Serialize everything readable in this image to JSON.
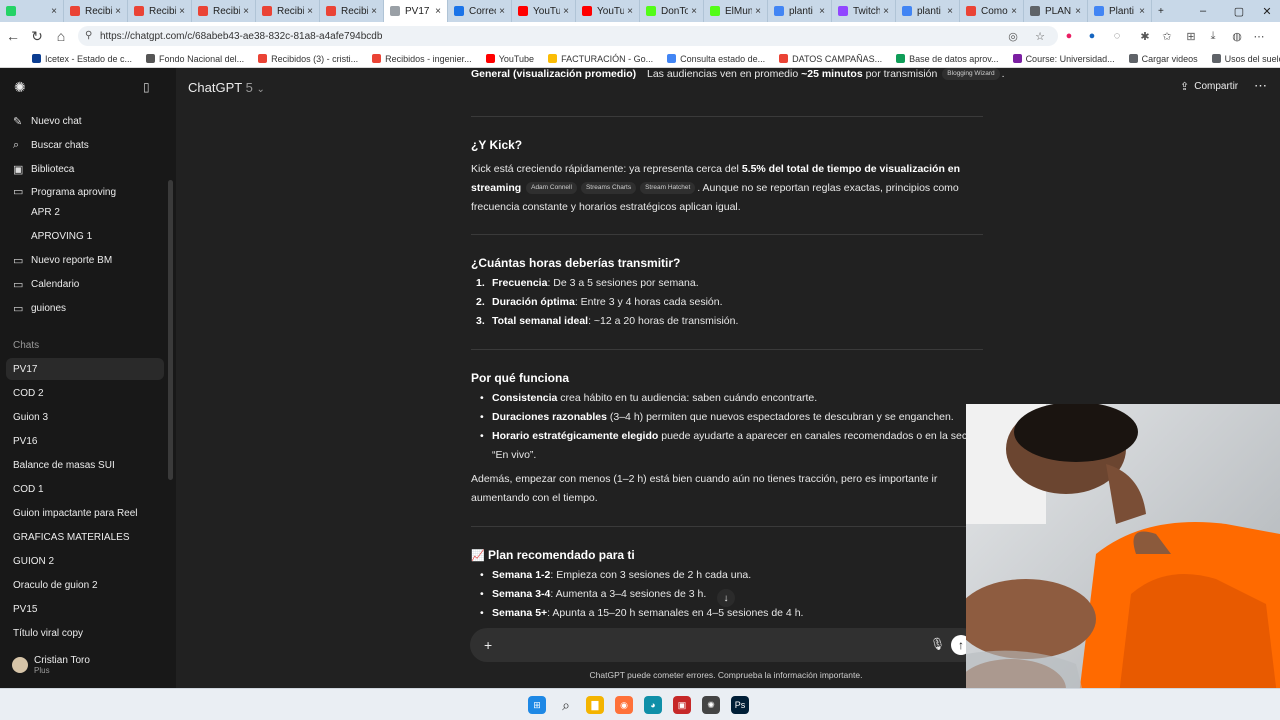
{
  "browser": {
    "tabs": [
      {
        "label": "",
        "color": "#25d366"
      },
      {
        "label": "Recibi",
        "color": "#ea4335"
      },
      {
        "label": "Recibi",
        "color": "#ea4335"
      },
      {
        "label": "Recibi",
        "color": "#ea4335"
      },
      {
        "label": "Recibi",
        "color": "#ea4335"
      },
      {
        "label": "Recibi",
        "color": "#ea4335"
      },
      {
        "label": "PV17",
        "color": "#9aa0a6",
        "active": true
      },
      {
        "label": "Correc",
        "color": "#1a73e8"
      },
      {
        "label": "YouTu",
        "color": "#ff0000"
      },
      {
        "label": "YouTu",
        "color": "#ff0000"
      },
      {
        "label": "DonTo",
        "color": "#53fc18"
      },
      {
        "label": "ElMun",
        "color": "#53fc18"
      },
      {
        "label": "planti",
        "color": "#4285f4"
      },
      {
        "label": "Twitch",
        "color": "#9146ff"
      },
      {
        "label": "planti",
        "color": "#4285f4"
      },
      {
        "label": "Como",
        "color": "#ea4335"
      },
      {
        "label": "PLAN",
        "color": "#5f6368"
      },
      {
        "label": "Planti",
        "color": "#4285f4"
      }
    ],
    "url": "https://chatgpt.com/c/68abeb43-ae38-832c-81a8-a4afe794bcdb",
    "bookmarks": [
      {
        "label": "Icetex - Estado de c...",
        "color": "#0b3d91"
      },
      {
        "label": "Fondo Nacional del...",
        "color": "#555555"
      },
      {
        "label": "Recibidos (3) - cristi...",
        "color": "#ea4335"
      },
      {
        "label": "Recibidos - ingenier...",
        "color": "#ea4335"
      },
      {
        "label": "YouTube",
        "color": "#ff0000"
      },
      {
        "label": "FACTURACIÓN - Go...",
        "color": "#fbbc04"
      },
      {
        "label": "Consulta estado de...",
        "color": "#4285f4"
      },
      {
        "label": "DATOS CAMPAÑAS...",
        "color": "#ea4335"
      },
      {
        "label": "Base de datos aprov...",
        "color": "#0f9d58"
      },
      {
        "label": "Course: Universidad...",
        "color": "#7b1fa2"
      },
      {
        "label": "Cargar videos",
        "color": "#5f6368"
      },
      {
        "label": "Usos del suelo palm...",
        "color": "#5f6368"
      }
    ]
  },
  "sidebar": {
    "top_items": [
      {
        "label": "Nuevo chat",
        "icon": "✎"
      },
      {
        "label": "Buscar chats",
        "icon": "⌕"
      },
      {
        "label": "Biblioteca",
        "icon": "▣"
      }
    ],
    "project_items": [
      {
        "label": "Programa aproving",
        "icon": "▭"
      },
      {
        "label": "APR 2",
        "icon": ""
      },
      {
        "label": "APROVING 1",
        "icon": ""
      },
      {
        "label": "Nuevo reporte BM",
        "icon": "▭"
      },
      {
        "label": "Calendario",
        "icon": "▭"
      },
      {
        "label": "guiones",
        "icon": "▭"
      }
    ],
    "chats_heading": "Chats",
    "chats": [
      "PV17",
      "COD 2",
      "Guion 3",
      "PV16",
      "Balance de masas SUI",
      "COD 1",
      "Guion impactante para Reel",
      "GRAFICAS MATERIALES",
      "GUION 2",
      "Oraculo de guion 2",
      "PV15",
      "Título viral copy"
    ],
    "user": {
      "name": "Cristian Toro",
      "plan": "Plus"
    }
  },
  "header": {
    "model": "ChatGPT",
    "version": "5",
    "share": "Compartir"
  },
  "content": {
    "top_row": {
      "label": "General (visualización promedio)",
      "text_pre": "Las audiencias ven en promedio ",
      "text_bold": "~25 minutos",
      "text_post": " por transmisión",
      "chip": "Blogging Wizard",
      "end": "."
    },
    "kick": {
      "title": "¿Y Kick?",
      "p_pre": "Kick está creciendo rápidamente: ya representa cerca del ",
      "p_bold": "5.5% del total de tiempo de visualización en streaming",
      "chips": [
        "Adam Connell",
        "Streams Charts",
        "Stream Hatchet"
      ],
      "p_post": ". Aunque no se reportan reglas exactas, principios como frecuencia constante y horarios estratégicos aplican igual."
    },
    "hours": {
      "title": "¿Cuántas horas deberías transmitir?",
      "items": [
        {
          "num": "1.",
          "bold": "Frecuencia",
          "text": ": De 3 a 5 sesiones por semana."
        },
        {
          "num": "2.",
          "bold": "Duración óptima",
          "text": ": Entre 3 y 4 horas cada sesión."
        },
        {
          "num": "3.",
          "bold": "Total semanal ideal",
          "text": ": ~12 a 20 horas de transmisión."
        }
      ]
    },
    "why": {
      "title": "Por qué funciona",
      "items": [
        {
          "bold": "Consistencia",
          "text": " crea hábito en tu audiencia: saben cuándo encontrarte."
        },
        {
          "bold": "Duraciones razonables",
          "text": " (3–4 h) permiten que nuevos espectadores te descubran y se enganchen."
        },
        {
          "bold": "Horario estratégicamente elegido",
          "text": " puede ayudarte a aparecer en canales recomendados o en la secc",
          "line2": "“En vivo”."
        }
      ],
      "para": "Además, empezar con menos (1–2 h) está bien cuando aún no tienes tracción, pero es importante ir aumentando con el tiempo."
    },
    "plan": {
      "icon": "📈",
      "title": "Plan recomendado para ti",
      "items": [
        {
          "bold": "Semana 1-2",
          "text": ": Empieza con 3 sesiones de 2 h cada una."
        },
        {
          "bold": "Semana 3-4",
          "text": ": Aumenta a 3–4 sesiones de 3 h."
        },
        {
          "bold": "Semana 5+",
          "text": ": Apunta a 15–20 h semanales en 4–5 sesiones de 4 h."
        }
      ]
    }
  },
  "composer": {
    "placeholder": "",
    "disclaimer": "ChatGPT puede cometer errores. Comprueba la información importante."
  },
  "taskbar": {
    "icons": [
      {
        "name": "windows-start-icon",
        "color": "#1e88e5",
        "glyph": "⊞"
      },
      {
        "name": "search-icon",
        "color": "#ffffff",
        "glyph": "⌕"
      },
      {
        "name": "file-explorer-icon",
        "color": "#f4b400",
        "glyph": "▇"
      },
      {
        "name": "firefox-icon",
        "color": "#ff7139",
        "glyph": "◉"
      },
      {
        "name": "edge-icon",
        "color": "#0f8fa8",
        "glyph": "◕"
      },
      {
        "name": "app-icon",
        "color": "#c62828",
        "glyph": "▣"
      },
      {
        "name": "chatgpt-app-icon",
        "color": "#444444",
        "glyph": "✺"
      },
      {
        "name": "photoshop-icon",
        "color": "#001e36",
        "glyph": "Ps"
      }
    ]
  }
}
